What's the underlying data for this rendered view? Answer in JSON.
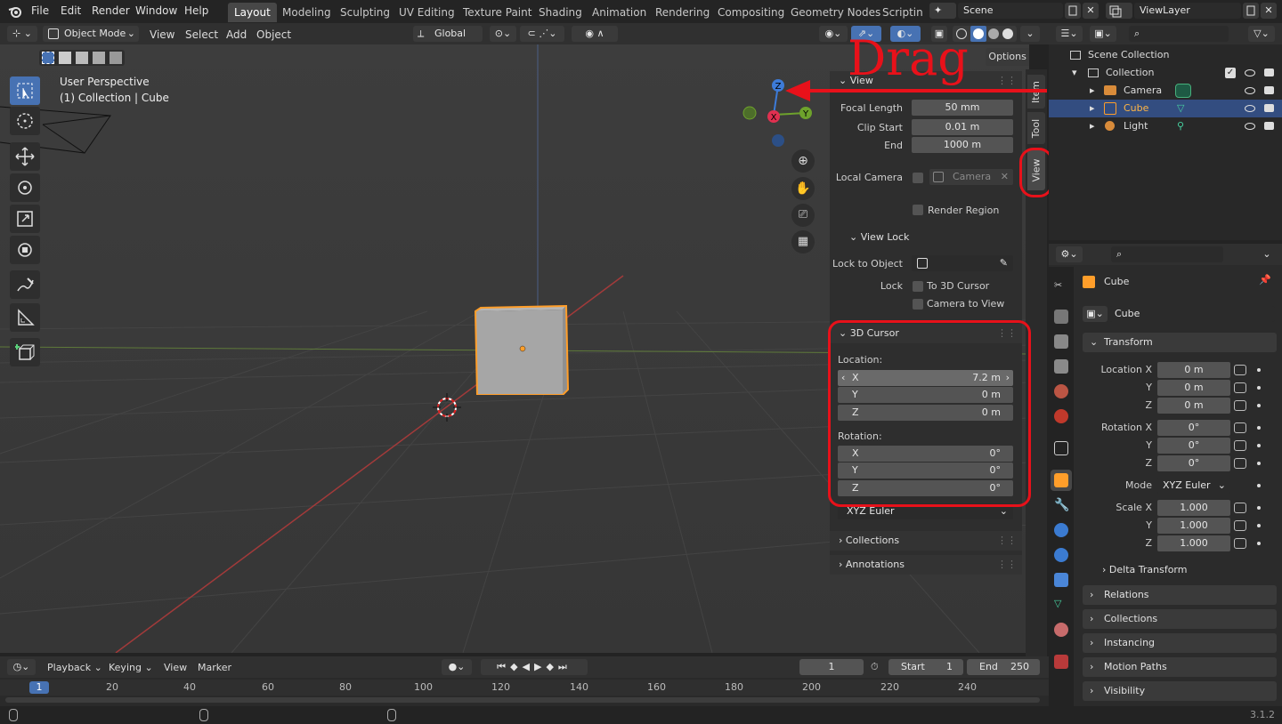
{
  "topbar": {
    "menus": [
      "File",
      "Edit",
      "Render",
      "Window",
      "Help"
    ],
    "workspaces": [
      "Layout",
      "Modeling",
      "Sculpting",
      "UV Editing",
      "Texture Paint",
      "Shading",
      "Animation",
      "Rendering",
      "Compositing",
      "Geometry Nodes",
      "Scripting"
    ],
    "active_workspace": "Layout",
    "scene": "Scene",
    "view_layer": "ViewLayer"
  },
  "viewport_header": {
    "mode": "Object Mode",
    "menus": [
      "View",
      "Select",
      "Add",
      "Object"
    ],
    "orientation": "Global",
    "options": "Options"
  },
  "viewport": {
    "perspective": "User Perspective",
    "collection_info": "(1) Collection | Cube",
    "gizmo": {
      "z": "Z",
      "x": "X",
      "y": "Y"
    },
    "annotation": "Drag"
  },
  "npanel": {
    "tabs": [
      "Item",
      "Tool",
      "View"
    ],
    "view_header": "View",
    "focal_length_label": "Focal Length",
    "focal_length": "50 mm",
    "clip_start_label": "Clip Start",
    "clip_start": "0.01 m",
    "clip_end_label": "End",
    "clip_end": "1000 m",
    "local_camera_label": "Local Camera",
    "local_camera": "Camera",
    "render_region": "Render Region",
    "view_lock_header": "View Lock",
    "lock_to_object_label": "Lock to Object",
    "lock_label": "Lock",
    "to_3d_cursor": "To 3D Cursor",
    "camera_to_view": "Camera to View",
    "cursor_header": "3D Cursor",
    "location_label": "Location:",
    "loc": [
      {
        "axis": "X",
        "value": "7.2 m"
      },
      {
        "axis": "Y",
        "value": "0 m"
      },
      {
        "axis": "Z",
        "value": "0 m"
      }
    ],
    "rotation_label": "Rotation:",
    "rot": [
      {
        "axis": "X",
        "value": "0°"
      },
      {
        "axis": "Y",
        "value": "0°"
      },
      {
        "axis": "Z",
        "value": "0°"
      }
    ],
    "rotation_mode": "XYZ Euler",
    "collections": "Collections",
    "annotations": "Annotations"
  },
  "outliner": {
    "root": "Scene Collection",
    "collection": "Collection",
    "items": [
      "Camera",
      "Cube",
      "Light"
    ]
  },
  "properties": {
    "object_name": "Cube",
    "data_name": "Cube",
    "transform_header": "Transform",
    "location_x_label": "Location X",
    "y_label": "Y",
    "z_label": "Z",
    "location": [
      "0 m",
      "0 m",
      "0 m"
    ],
    "rotation_x_label": "Rotation X",
    "rotation": [
      "0°",
      "0°",
      "0°"
    ],
    "mode_label": "Mode",
    "mode": "XYZ Euler",
    "scale_x_label": "Scale X",
    "scale": [
      "1.000",
      "1.000",
      "1.000"
    ],
    "delta_transform": "Delta Transform",
    "sections": [
      "Relations",
      "Collections",
      "Instancing",
      "Motion Paths",
      "Visibility"
    ]
  },
  "timeline": {
    "menus": [
      "Playback",
      "Keying",
      "View",
      "Marker"
    ],
    "current_frame": "1",
    "start_label": "Start",
    "start": "1",
    "end_label": "End",
    "end": "250",
    "ticks": [
      "20",
      "40",
      "60",
      "80",
      "100",
      "120",
      "140",
      "160",
      "180",
      "200",
      "220",
      "240"
    ],
    "playhead": "1"
  },
  "status": {
    "version": "3.1.2"
  },
  "colors": {
    "accent": "#4772b3",
    "selected_orange": "#ff9e2a",
    "annotation_red": "#e8111a"
  }
}
